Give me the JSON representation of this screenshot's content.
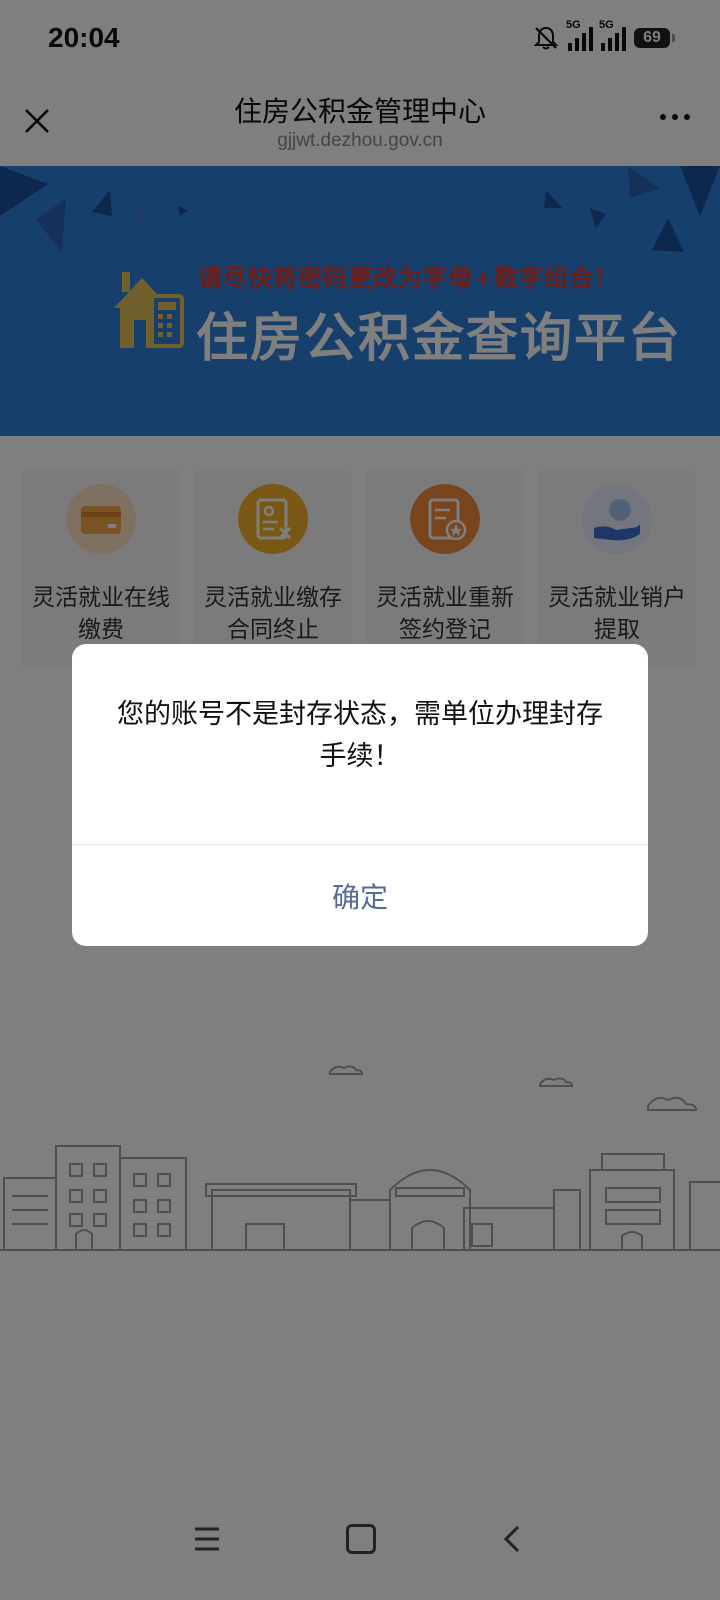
{
  "status_bar": {
    "time": "20:04",
    "network_1": "5G",
    "network_2": "5G",
    "battery": "69",
    "icons": [
      "bell-muted-icon",
      "signal-icon",
      "signal-icon",
      "battery-icon"
    ]
  },
  "title_bar": {
    "title": "住房公积金管理中心",
    "url": "gjjwt.dezhou.gov.cn",
    "close_icon": "close-icon",
    "more_icon": "more-icon"
  },
  "banner": {
    "notice": "请尽快将密码更改为字母+数字组合！",
    "title": "住房公积金查询平台",
    "icon": "house-calculator-icon"
  },
  "services": [
    {
      "label": "灵活就业在线缴费",
      "icon": "card-icon",
      "color": "#f3a646"
    },
    {
      "label": "灵活就业缴存合同终止",
      "icon": "contract-stop-icon",
      "color": "#f2b12a"
    },
    {
      "label": "灵活就业重新签约登记",
      "icon": "sign-register-icon",
      "color": "#f08a3c"
    },
    {
      "label": "灵活就业销户提取",
      "icon": "hand-coin-icon",
      "color": "#a7c2ee"
    }
  ],
  "dialog": {
    "message": "您的账号不是封存状态，需单位办理封存手续！",
    "confirm": "确定",
    "confirm_color": "#576b95"
  },
  "nav_bar": {
    "icons": [
      "menu-icon",
      "home-icon",
      "back-icon"
    ]
  },
  "colors": {
    "banner_bg": "#2f7fd8",
    "notice_red": "#e23b2a",
    "overlay": "rgba(0,0,0,0.5)"
  }
}
